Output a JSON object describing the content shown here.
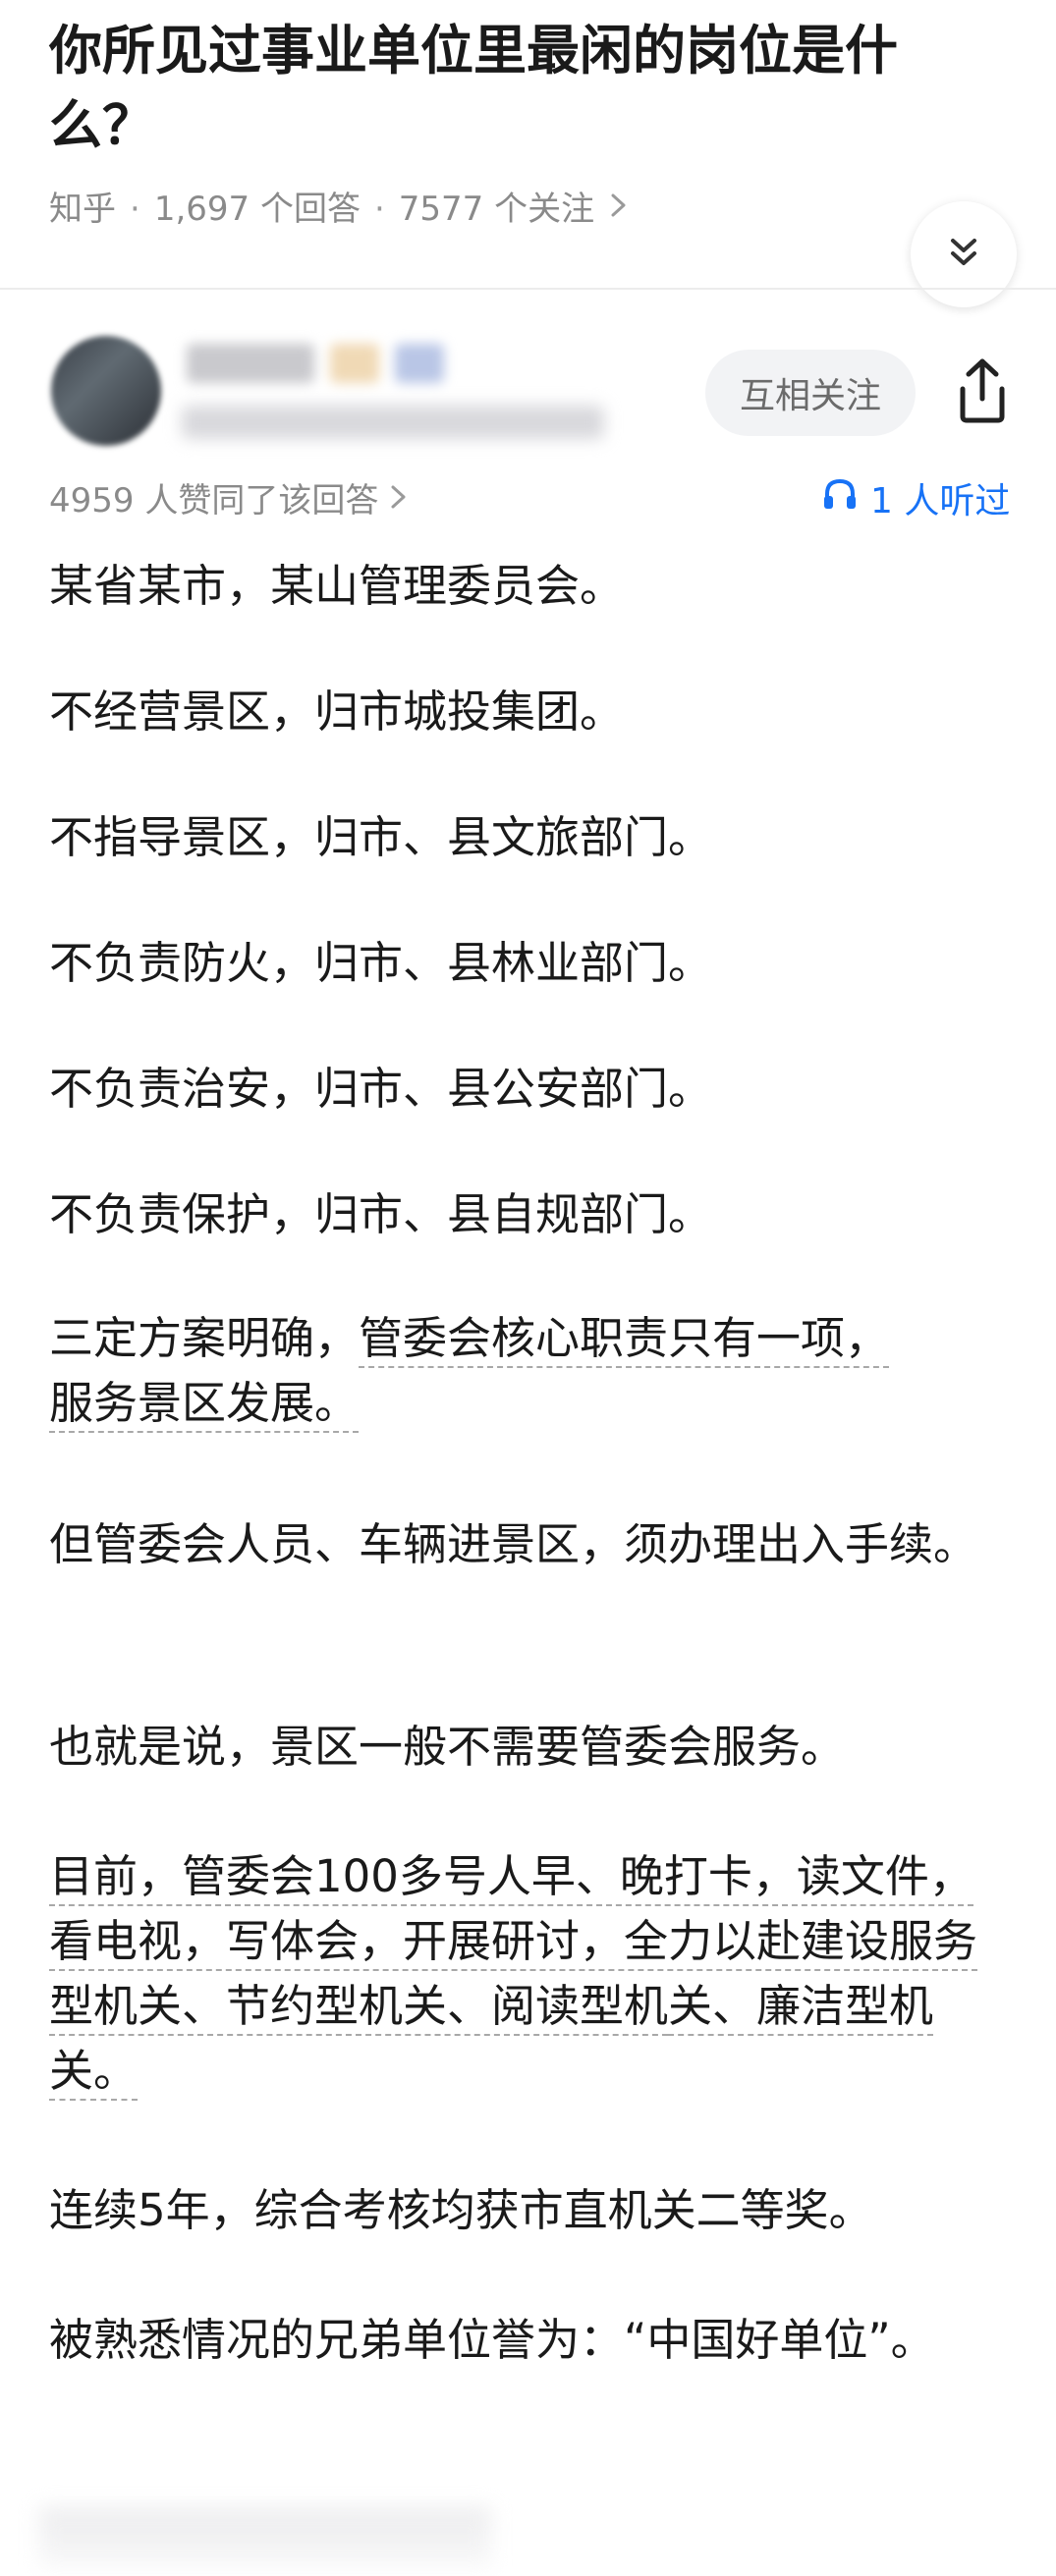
{
  "question": {
    "title": "你所见过事业单位里最闲的岗位是什么？",
    "source": "知乎",
    "answers": "1,697 个回答",
    "followers": "7577 个关注"
  },
  "author": {
    "follow_label": "互相关注"
  },
  "stats": {
    "votes": "4959 人赞同了该回答",
    "listeners": "1 人听过"
  },
  "answer": {
    "p1": "某省某市，某山管理委员会。",
    "p2": "不经营景区，归市城投集团。",
    "p3": "不指导景区，归市、县文旅部门。",
    "p4": "不负责防火，归市、县林业部门。",
    "p5": "不负责治安，归市、县公安部门。",
    "p6": "不负责保护，归市、县自规部门。",
    "p7_a": "三定方案明确，",
    "p7_b": "管委会核心职责只有一项，",
    "p7_c": "服务景区发展。",
    "p8": "但管委会人员、车辆进景区，须办理出入手续。",
    "p9": "也就是说，景区一般不需要管委会服务。",
    "p10_a": "目前，管委会100多号人早、晚打卡，读文件，看电视，写体会，开展研讨，全力以赴建设服务型机关、节约型机关、阅读型机",
    "p10_b": "关、廉洁型机关。",
    "p11": "连续5年，综合考核均获市直机关二等奖。",
    "p12": "被熟悉情况的兄弟单位誉为：“中国好单位”。"
  },
  "icons": [
    "collapse-chevron-icon",
    "share-icon",
    "headphone-icon",
    "chevron-right-icon"
  ],
  "colors": {
    "accent": "#1772f6",
    "meta": "#8a8a8a",
    "text": "#1a1a1a"
  }
}
